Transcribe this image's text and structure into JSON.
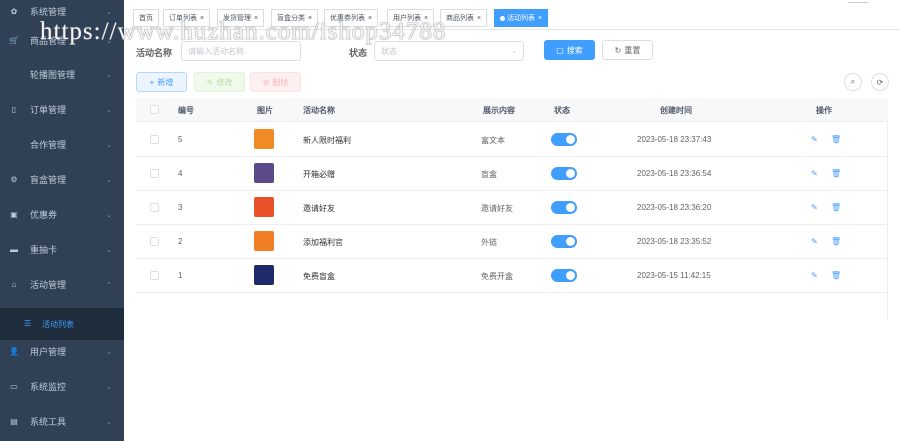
{
  "sidebar": {
    "items": [
      {
        "label": "系统管理",
        "icon": "gear-icon",
        "glyph": "✿"
      },
      {
        "label": "商品管理",
        "icon": "cart-icon",
        "glyph": "🛒"
      },
      {
        "label": "轮播图管理",
        "icon": "image-icon",
        "glyph": ""
      },
      {
        "label": "订单管理",
        "icon": "order-icon",
        "glyph": "▯"
      },
      {
        "label": "合作管理",
        "icon": "cooperation-icon",
        "glyph": ""
      },
      {
        "label": "盲盒管理",
        "icon": "box-icon",
        "glyph": "⚙"
      },
      {
        "label": "优惠券",
        "icon": "coupon-icon",
        "glyph": "▣"
      },
      {
        "label": "重抽卡",
        "icon": "card-icon",
        "glyph": "▬"
      },
      {
        "label": "活动管理",
        "icon": "home-icon",
        "glyph": "⌂"
      },
      {
        "label": "用户管理",
        "icon": "user-icon",
        "glyph": "👤"
      },
      {
        "label": "系统监控",
        "icon": "monitor-icon",
        "glyph": "▭"
      },
      {
        "label": "系统工具",
        "icon": "tools-icon",
        "glyph": "▤"
      }
    ],
    "active_sub": {
      "label": "活动列表",
      "icon": "list-icon",
      "glyph": "☰"
    }
  },
  "tags": [
    {
      "label": "首页",
      "closable": false
    },
    {
      "label": "订单列表",
      "closable": true
    },
    {
      "label": "发货管理",
      "closable": true
    },
    {
      "label": "盲盒分类",
      "closable": true
    },
    {
      "label": "优惠券列表",
      "closable": true
    },
    {
      "label": "用户列表",
      "closable": true
    },
    {
      "label": "商品列表",
      "closable": true
    },
    {
      "label": "活动列表",
      "closable": true,
      "active": true
    }
  ],
  "search": {
    "name_label": "活动名称",
    "name_placeholder": "请输入活动名称",
    "status_label": "状态",
    "status_placeholder": "状态",
    "search_btn": "搜索",
    "reset_btn": "重置"
  },
  "toolbar": {
    "add": "新增",
    "edit": "修改",
    "delete": "删除"
  },
  "table": {
    "headers": [
      "编号",
      "图片",
      "活动名称",
      "展示内容",
      "状态",
      "创建时间",
      "操作"
    ],
    "rows": [
      {
        "id": "5",
        "name": "新人限时福利",
        "content": "富文本",
        "status": true,
        "created": "2023-05-18 23:37:43",
        "thumb": "#f08a24"
      },
      {
        "id": "4",
        "name": "开箱必赠",
        "content": "盲盒",
        "status": true,
        "created": "2023-05-18 23:36:54",
        "thumb": "#5a4a8a"
      },
      {
        "id": "3",
        "name": "邀请好友",
        "content": "邀请好友",
        "status": true,
        "created": "2023-05-18 23:36:20",
        "thumb": "#e8532b"
      },
      {
        "id": "2",
        "name": "添加福利官",
        "content": "外链",
        "status": true,
        "created": "2023-05-18 23:35:52",
        "thumb": "#f07e26"
      },
      {
        "id": "1",
        "name": "免费盲盒",
        "content": "免费开盒",
        "status": true,
        "created": "2023-05-15 11:42:15",
        "thumb": "#1f2a6b"
      }
    ]
  },
  "watermark": "https://www.huzhan.com/ishop34788",
  "colors": {
    "primary": "#409eff",
    "sidebar_bg": "#304156"
  }
}
